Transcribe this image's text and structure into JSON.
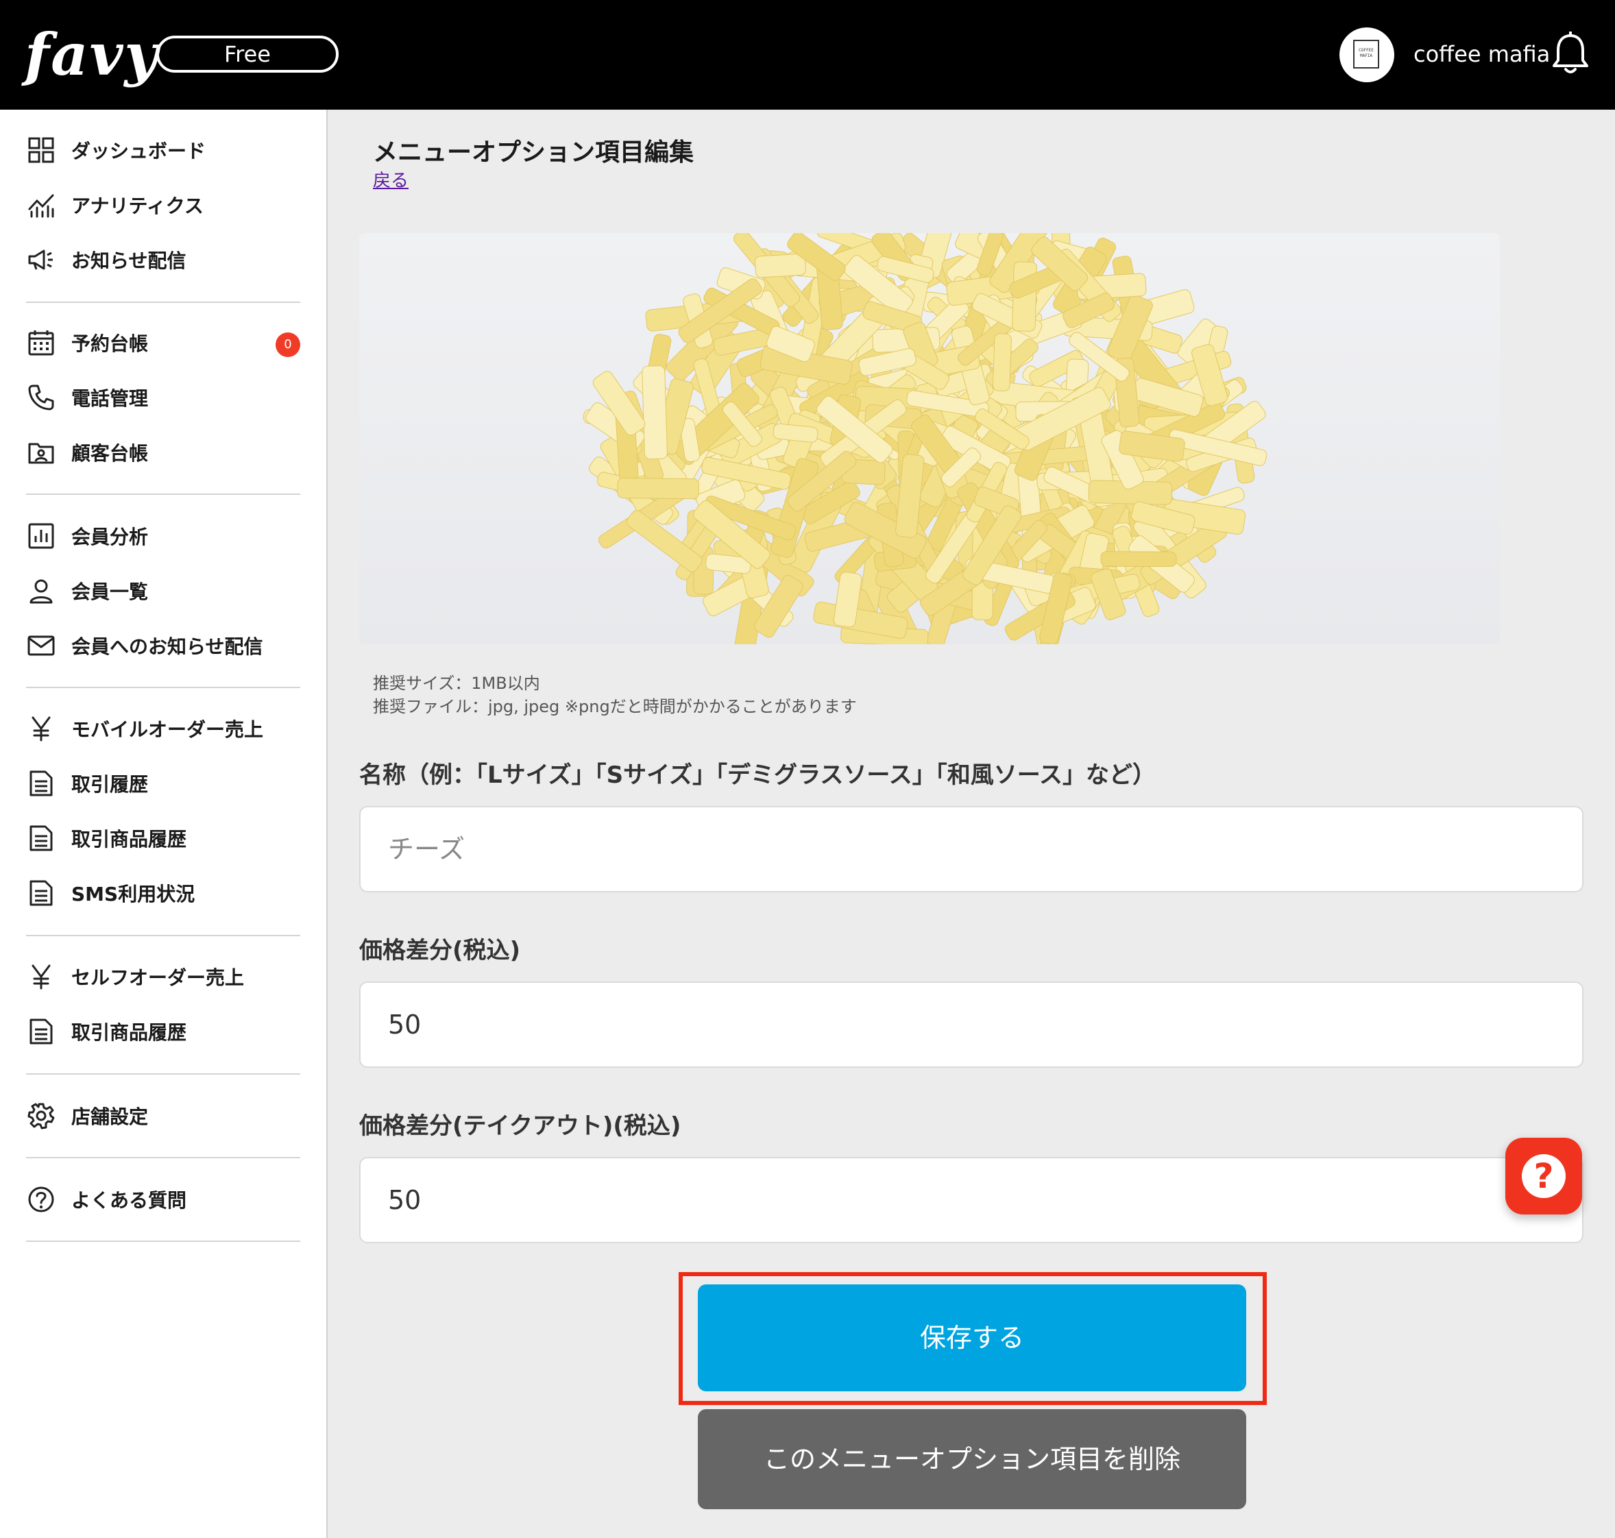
{
  "header": {
    "logo": "favy",
    "plan_badge": "Free",
    "avatar_text": "COFFEE MAFIA",
    "shop_name": "coffee mafia"
  },
  "sidebar": {
    "items": [
      {
        "label": "ダッシュボード",
        "icon": "grid-icon"
      },
      {
        "label": "アナリティクス",
        "icon": "analytics-icon"
      },
      {
        "label": "お知らせ配信",
        "icon": "megaphone-icon"
      },
      {
        "label": "予約台帳",
        "icon": "calendar-icon",
        "badge": "0"
      },
      {
        "label": "電話管理",
        "icon": "phone-icon"
      },
      {
        "label": "顧客台帳",
        "icon": "contact-folder-icon"
      },
      {
        "label": "会員分析",
        "icon": "bar-chart-icon"
      },
      {
        "label": "会員一覧",
        "icon": "user-icon"
      },
      {
        "label": "会員へのお知らせ配信",
        "icon": "mail-icon"
      },
      {
        "label": "モバイルオーダー売上",
        "icon": "yen-icon"
      },
      {
        "label": "取引履歴",
        "icon": "document-icon"
      },
      {
        "label": "取引商品履歴",
        "icon": "document-icon"
      },
      {
        "label": "SMS利用状況",
        "icon": "document-icon"
      },
      {
        "label": "セルフオーダー売上",
        "icon": "yen-icon"
      },
      {
        "label": "取引商品履歴",
        "icon": "document-icon"
      },
      {
        "label": "店舗設定",
        "icon": "gear-icon"
      },
      {
        "label": "よくある質問",
        "icon": "question-icon"
      }
    ]
  },
  "main": {
    "title": "メニューオプション項目編集",
    "back_link": "戻る",
    "image_hint_size": "推奨サイズ：1MB以内",
    "image_hint_file": "推奨ファイル：jpg, jpeg ※pngだと時間がかかることがあります",
    "name_label": "名称（例：「Lサイズ」「Sサイズ」「デミグラスソース」「和風ソース」など）",
    "name_value": "チーズ",
    "price_label": "価格差分(税込)",
    "price_value": "50",
    "takeout_label": "価格差分(テイクアウト)(税込)",
    "takeout_value": "50",
    "save_button": "保存する",
    "delete_button": "このメニューオプション項目を削除"
  },
  "help_button": "?",
  "colors": {
    "header_bg": "#000000",
    "save_button": "#00a4e0",
    "delete_button": "#666666",
    "highlight": "#ee2a14",
    "badge": "#f03b26",
    "help_button": "#f0331e"
  }
}
